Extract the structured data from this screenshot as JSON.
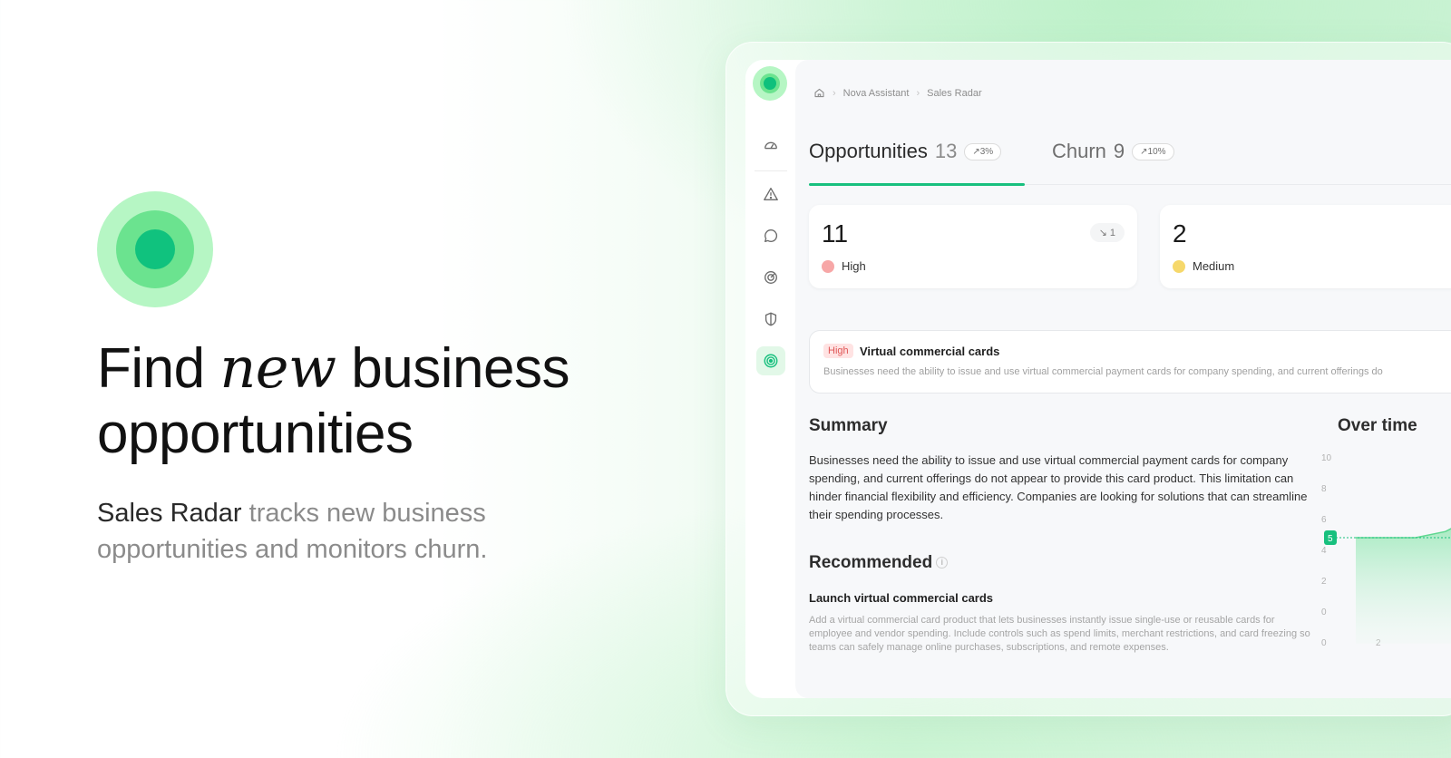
{
  "hero": {
    "title_part1": "Find ",
    "title_accent": "new",
    "title_part2": " business",
    "title_line2": "opportunities",
    "subtitle_brand": "Sales Radar",
    "subtitle_rest": " tracks new business opportunities and monitors churn."
  },
  "colors": {
    "accent": "#18c07e",
    "high": "#f7a7a7",
    "medium": "#f6d86b"
  },
  "sidebar": {
    "items": [
      {
        "icon": "dashboard-gauge-icon"
      },
      {
        "icon": "warning-triangle-icon"
      },
      {
        "icon": "chat-bubble-icon"
      },
      {
        "icon": "target-icon"
      },
      {
        "icon": "shield-icon"
      },
      {
        "icon": "radar-icon",
        "active": true
      }
    ]
  },
  "breadcrumb": {
    "items": [
      "Nova Assistant",
      "Sales Radar"
    ]
  },
  "tabs": [
    {
      "label": "Opportunities",
      "count": "13",
      "delta": "↗3%"
    },
    {
      "label": "Churn",
      "count": "9",
      "delta": "↗10%"
    }
  ],
  "stats": [
    {
      "value": "11",
      "label": "High",
      "delta": "↘ 1"
    },
    {
      "value": "2",
      "label": "Medium"
    }
  ],
  "opportunity": {
    "badge": "High",
    "title": "Virtual commercial cards",
    "description": "Businesses need the ability to issue and use virtual commercial payment cards for company spending, and current offerings do"
  },
  "summary": {
    "heading": "Summary",
    "text": "Businesses need the ability to issue and use virtual commercial payment cards for company spending, and current offerings do not appear to provide this card product. This limitation can hinder financial flexibility and efficiency. Companies are looking for solutions that can streamline their spending processes."
  },
  "recommended": {
    "heading": "Recommended",
    "item_title": "Launch virtual commercial cards",
    "item_desc": "Add a virtual commercial card product that lets businesses instantly issue single-use or reusable cards for employee and vendor spending. Include controls such as spend limits, merchant restrictions, and card freezing so teams can safely manage online purchases, subscriptions, and remote expenses."
  },
  "over_time": {
    "heading": "Over time",
    "highlight_label": "5"
  },
  "chart_data": {
    "type": "area",
    "title": "Over time",
    "y_ticks": [
      "10",
      "8",
      "6",
      "4",
      "2",
      "0",
      "0"
    ],
    "x_ticks": [
      "2"
    ],
    "ylim": [
      0,
      10
    ],
    "series": [
      {
        "x": [
          0,
          1,
          2,
          3,
          4
        ],
        "values": [
          5,
          5,
          5,
          5.4,
          6.4
        ]
      }
    ],
    "highlight": {
      "value": 5,
      "label": "5"
    },
    "grid": false
  }
}
